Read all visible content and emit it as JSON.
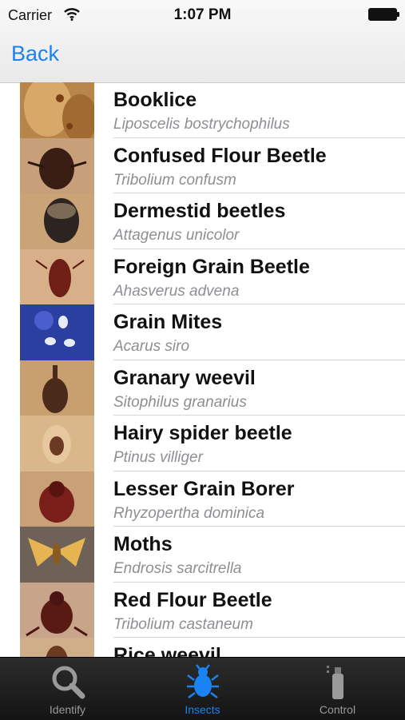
{
  "status": {
    "carrier": "Carrier",
    "time": "1:07 PM"
  },
  "nav": {
    "back_label": "Back"
  },
  "insects": [
    {
      "name": "Booklice",
      "latin": "Liposcelis bostrychophilus"
    },
    {
      "name": "Confused Flour Beetle",
      "latin": "Tribolium confusm"
    },
    {
      "name": "Dermestid beetles",
      "latin": "Attagenus unicolor"
    },
    {
      "name": "Foreign Grain Beetle",
      "latin": "Ahasverus advena"
    },
    {
      "name": "Grain Mites",
      "latin": "Acarus siro"
    },
    {
      "name": "Granary weevil",
      "latin": "Sitophilus granarius"
    },
    {
      "name": "Hairy spider beetle",
      "latin": "Ptinus villiger"
    },
    {
      "name": "Lesser Grain Borer",
      "latin": "Rhyzopertha dominica"
    },
    {
      "name": "Moths",
      "latin": "Endrosis sarcitrella"
    },
    {
      "name": "Red Flour Beetle",
      "latin": "Tribolium castaneum"
    },
    {
      "name": "Rice weevil",
      "latin": ""
    }
  ],
  "tabs": [
    {
      "label": "Identify",
      "icon": "search-icon",
      "active": false
    },
    {
      "label": "Insects",
      "icon": "bug-icon",
      "active": true
    },
    {
      "label": "Control",
      "icon": "spray-can-icon",
      "active": false
    }
  ],
  "colors": {
    "accent": "#1a82f2",
    "tab_inactive": "#9a9a9a"
  }
}
